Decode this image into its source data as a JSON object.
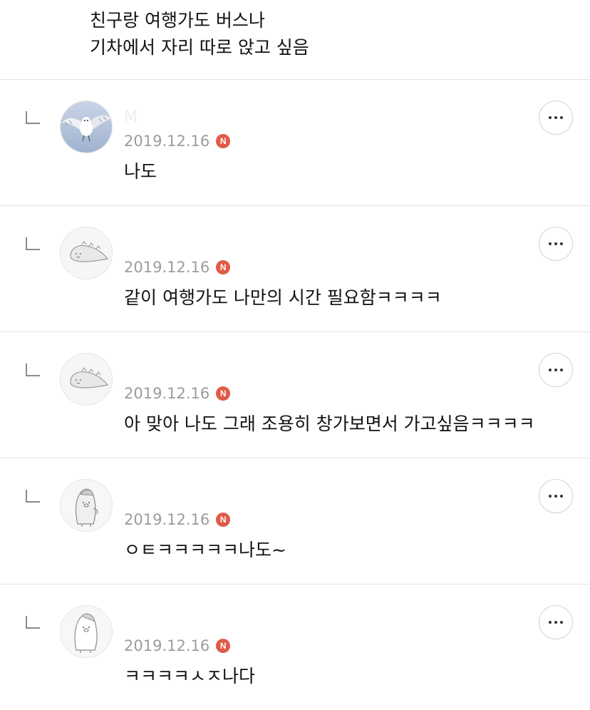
{
  "top_comment": {
    "lines": [
      "친구랑 여행가도 버스나",
      "기차에서 자리 따로 앉고 싶음"
    ]
  },
  "replies": [
    {
      "nickname": "M",
      "date": "2019.12.16",
      "badge": "N",
      "text": "나도",
      "avatar": "bird-photo"
    },
    {
      "nickname": "",
      "date": "2019.12.16",
      "badge": "N",
      "text": "같이 여행가도 나만의 시간 필요함ㅋㅋㅋㅋ",
      "avatar": "seal-doodle"
    },
    {
      "nickname": "",
      "date": "2019.12.16",
      "badge": "N",
      "text": "아 맞아 나도 그래 조용히 창가보면서 가고싶음ㅋㅋㅋㅋ",
      "avatar": "seal-doodle"
    },
    {
      "nickname": "",
      "date": "2019.12.16",
      "badge": "N",
      "text": "ㅇㅌㅋㅋㅋㅋㅋ나도~",
      "avatar": "penguin-doodle"
    },
    {
      "nickname": "",
      "date": "2019.12.16",
      "badge": "N",
      "text": "ㅋㅋㅋㅋㅅㅈ나다",
      "avatar": "penguin-doodle"
    }
  ],
  "colors": {
    "badge": "#e05a47",
    "date": "#9c9c9c",
    "divider": "#e2e2e2"
  }
}
